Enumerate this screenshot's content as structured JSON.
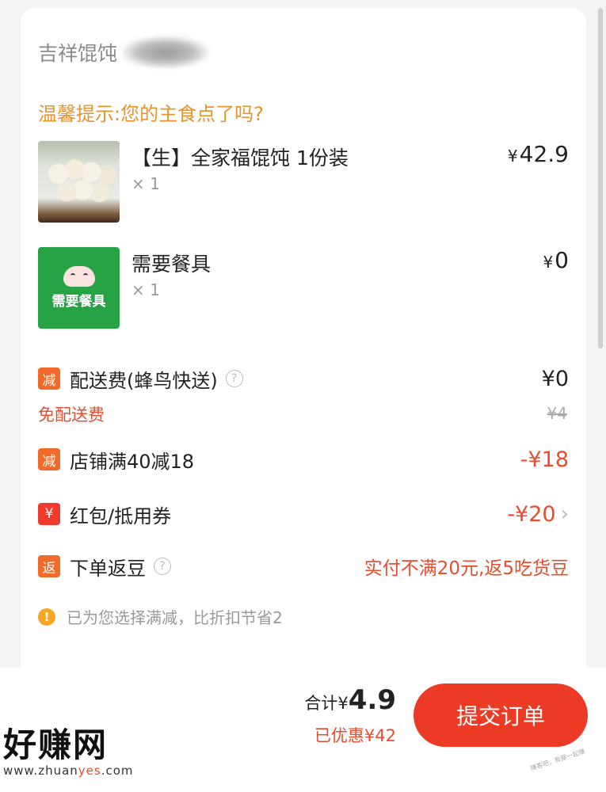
{
  "store": {
    "name": "吉祥馄饨"
  },
  "tip": "温馨提示:您的主食点了吗?",
  "items": [
    {
      "name": "【生】全家福馄饨 1份装",
      "qty": "× 1",
      "yen": "¥",
      "price": "42.9"
    },
    {
      "name": "需要餐具",
      "qty": "× 1",
      "yen": "¥",
      "price": "0",
      "thumb_text": "需要餐具"
    }
  ],
  "delivery": {
    "tag": "减",
    "label": "配送费(蜂鸟快送)",
    "help": "?",
    "value": "¥0",
    "sub_label": "免配送费",
    "original": "¥4"
  },
  "shop_discount": {
    "tag": "减",
    "label": "店铺满40减18",
    "value": "-¥18"
  },
  "coupon": {
    "tag": "¥",
    "label": "红包/抵用券",
    "value": "-¥20",
    "chevron": "›"
  },
  "rebate": {
    "tag": "返",
    "label": "下单返豆",
    "help": "?",
    "value": "实付不满20元,返5吃货豆"
  },
  "notice": {
    "icon": "!",
    "text": "已为您选择满减，比折扣节省2"
  },
  "footer": {
    "total_label": "合计¥",
    "total_value": "4.9",
    "saved": "已优惠¥42",
    "submit_label": "提交订单"
  },
  "watermark": {
    "title": "好赚网",
    "url_a": "www.zhuan",
    "url_hl": "yes",
    "url_b": ".com",
    "stamp": "赚客吧，有屋一起赚"
  },
  "colors": {
    "accent": "#ec3a24",
    "tag_orange": "#f26a2a",
    "tip": "#e8932a",
    "discount_text": "#e84c2f"
  }
}
